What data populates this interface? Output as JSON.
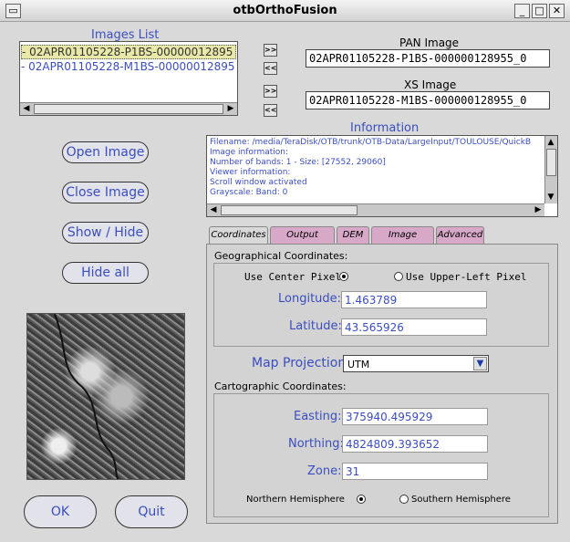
{
  "window": {
    "title": "otbOrthoFusion",
    "btn_min": "_",
    "btn_max": "□",
    "btn_close": "✕"
  },
  "images_list": {
    "title": "Images List",
    "items": [
      "- 02APR01105228-P1BS-00000012895",
      "- 02APR01105228-M1BS-00000012895"
    ]
  },
  "pan": {
    "label": "PAN Image",
    "value": "02APR01105228-P1BS-000000128955_0",
    "add": ">>",
    "remove": "<<"
  },
  "xs": {
    "label": "XS Image",
    "value": "02APR01105228-M1BS-000000128955_0",
    "add": ">>",
    "remove": "<<"
  },
  "information": {
    "title": "Information",
    "lines": [
      "Filename: /media/TeraDisk/OTB/trunk/OTB-Data/LargeInput/TOULOUSE/QuickB",
      "Image information:",
      "Number of bands: 1 - Size: [27552, 29060]",
      "Viewer information:",
      "Scroll window activated",
      "Grayscale:  Band: 0"
    ]
  },
  "buttons": {
    "open": "Open Image",
    "close": "Close Image",
    "show_hide": "Show / Hide",
    "hide_all": "Hide all",
    "ok": "OK",
    "quit": "Quit"
  },
  "tabs": [
    "Coordinates",
    "Output Image",
    "DEM",
    "Image Extent",
    "Advanced"
  ],
  "geo": {
    "title": "Geographical Coordinates:",
    "use_center": "Use Center Pixel",
    "use_upper_left": "Use Upper-Left Pixel",
    "longitude_label": "Longitude:",
    "longitude": "1.463789",
    "latitude_label": "Latitude:",
    "latitude": "43.565926"
  },
  "projection": {
    "label": "Map Projection",
    "value": "UTM"
  },
  "carto": {
    "title": "Cartographic Coordinates:",
    "easting_label": "Easting:",
    "easting": "375940.495929",
    "northing_label": "Northing:",
    "northing": "4824809.393652",
    "zone_label": "Zone:",
    "zone": "31",
    "north": "Northern Hemisphere",
    "south": "Southern Hemisphere"
  },
  "colors": {
    "accent": "#3a4ec0",
    "tab_pink": "#d8a8c8",
    "bg": "#d9d9d9"
  }
}
